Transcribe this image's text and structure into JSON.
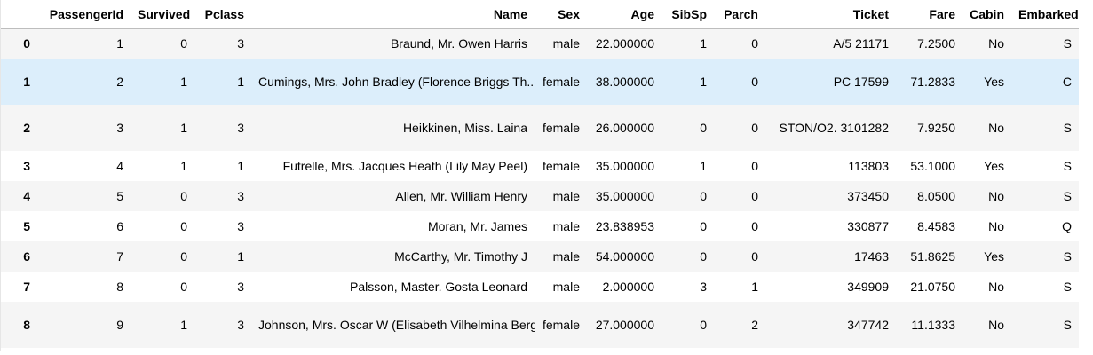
{
  "columns": [
    "",
    "PassengerId",
    "Survived",
    "Pclass",
    "Name",
    "Sex",
    "Age",
    "SibSp",
    "Parch",
    "Ticket",
    "Fare",
    "Cabin",
    "Embarked"
  ],
  "rows": [
    {
      "index": "0",
      "PassengerId": "1",
      "Survived": "0",
      "Pclass": "3",
      "Name": "Braund, Mr. Owen Harris",
      "Sex": "male",
      "Age": "22.000000",
      "SibSp": "1",
      "Parch": "0",
      "Ticket": "A/5 21171",
      "Fare": "7.2500",
      "Cabin": "No",
      "Embarked": "S"
    },
    {
      "index": "1",
      "PassengerId": "2",
      "Survived": "1",
      "Pclass": "1",
      "Name": "Cumings, Mrs. John Bradley (Florence Briggs Th...",
      "Sex": "female",
      "Age": "38.000000",
      "SibSp": "1",
      "Parch": "0",
      "Ticket": "PC 17599",
      "Fare": "71.2833",
      "Cabin": "Yes",
      "Embarked": "C"
    },
    {
      "index": "2",
      "PassengerId": "3",
      "Survived": "1",
      "Pclass": "3",
      "Name": "Heikkinen, Miss. Laina",
      "Sex": "female",
      "Age": "26.000000",
      "SibSp": "0",
      "Parch": "0",
      "Ticket": "STON/O2. 3101282",
      "Fare": "7.9250",
      "Cabin": "No",
      "Embarked": "S"
    },
    {
      "index": "3",
      "PassengerId": "4",
      "Survived": "1",
      "Pclass": "1",
      "Name": "Futrelle, Mrs. Jacques Heath (Lily May Peel)",
      "Sex": "female",
      "Age": "35.000000",
      "SibSp": "1",
      "Parch": "0",
      "Ticket": "113803",
      "Fare": "53.1000",
      "Cabin": "Yes",
      "Embarked": "S"
    },
    {
      "index": "4",
      "PassengerId": "5",
      "Survived": "0",
      "Pclass": "3",
      "Name": "Allen, Mr. William Henry",
      "Sex": "male",
      "Age": "35.000000",
      "SibSp": "0",
      "Parch": "0",
      "Ticket": "373450",
      "Fare": "8.0500",
      "Cabin": "No",
      "Embarked": "S"
    },
    {
      "index": "5",
      "PassengerId": "6",
      "Survived": "0",
      "Pclass": "3",
      "Name": "Moran, Mr. James",
      "Sex": "male",
      "Age": "23.838953",
      "SibSp": "0",
      "Parch": "0",
      "Ticket": "330877",
      "Fare": "8.4583",
      "Cabin": "No",
      "Embarked": "Q"
    },
    {
      "index": "6",
      "PassengerId": "7",
      "Survived": "0",
      "Pclass": "1",
      "Name": "McCarthy, Mr. Timothy J",
      "Sex": "male",
      "Age": "54.000000",
      "SibSp": "0",
      "Parch": "0",
      "Ticket": "17463",
      "Fare": "51.8625",
      "Cabin": "Yes",
      "Embarked": "S"
    },
    {
      "index": "7",
      "PassengerId": "8",
      "Survived": "0",
      "Pclass": "3",
      "Name": "Palsson, Master. Gosta Leonard",
      "Sex": "male",
      "Age": "2.000000",
      "SibSp": "3",
      "Parch": "1",
      "Ticket": "349909",
      "Fare": "21.0750",
      "Cabin": "No",
      "Embarked": "S"
    },
    {
      "index": "8",
      "PassengerId": "9",
      "Survived": "1",
      "Pclass": "3",
      "Name": "Johnson, Mrs. Oscar W (Elisabeth Vilhelmina Berg)",
      "Sex": "female",
      "Age": "27.000000",
      "SibSp": "0",
      "Parch": "2",
      "Ticket": "347742",
      "Fare": "11.1333",
      "Cabin": "No",
      "Embarked": "S"
    }
  ],
  "colors": {
    "hover_row": "#dceefb",
    "striped_row": "#f5f5f5",
    "header_border": "#bdbdbd"
  }
}
